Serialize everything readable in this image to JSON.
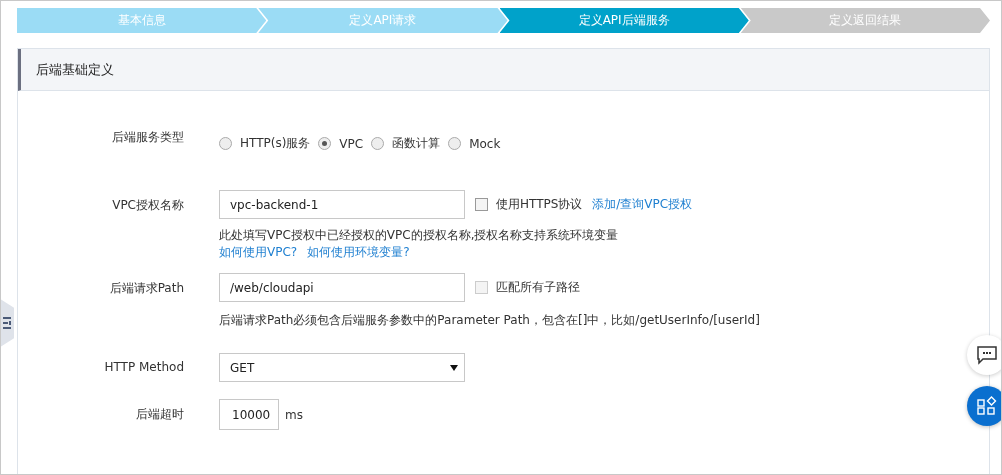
{
  "steps": [
    {
      "label": "基本信息",
      "selected": false,
      "completed": true
    },
    {
      "label": "定义API请求",
      "selected": false,
      "completed": true
    },
    {
      "label": "定义API后端服务",
      "selected": true,
      "completed": false
    },
    {
      "label": "定义返回结果",
      "selected": false,
      "completed": false
    }
  ],
  "section_title": "后端基础定义",
  "backend_type": {
    "label": "后端服务类型",
    "options": [
      {
        "label": "HTTP(s)服务",
        "selected": false
      },
      {
        "label": "VPC",
        "selected": true
      },
      {
        "label": "函数计算",
        "selected": false
      },
      {
        "label": "Mock",
        "selected": false
      }
    ]
  },
  "vpc_auth": {
    "label": "VPC授权名称",
    "value": "vpc-backend-1",
    "https_checkbox": {
      "label": "使用HTTPS协议",
      "checked": false
    },
    "link": "添加/查询VPC授权",
    "hint": "此处填写VPC授权中已经授权的VPC的授权名称,授权名称支持系统环境变量",
    "help_links": [
      "如何使用VPC?",
      "如何使用环境变量?"
    ]
  },
  "path": {
    "label": "后端请求Path",
    "value": "/web/cloudapi",
    "match_all_checkbox": {
      "label": "匹配所有子路径",
      "checked": false,
      "disabled": true
    },
    "hint": "后端请求Path必须包含后端服务参数中的Parameter Path，包含在[]中，比如/getUserInfo/[userId]"
  },
  "http_method": {
    "label": "HTTP Method",
    "value": "GET"
  },
  "timeout": {
    "label": "后端超时",
    "value": "10000",
    "unit": "ms"
  }
}
